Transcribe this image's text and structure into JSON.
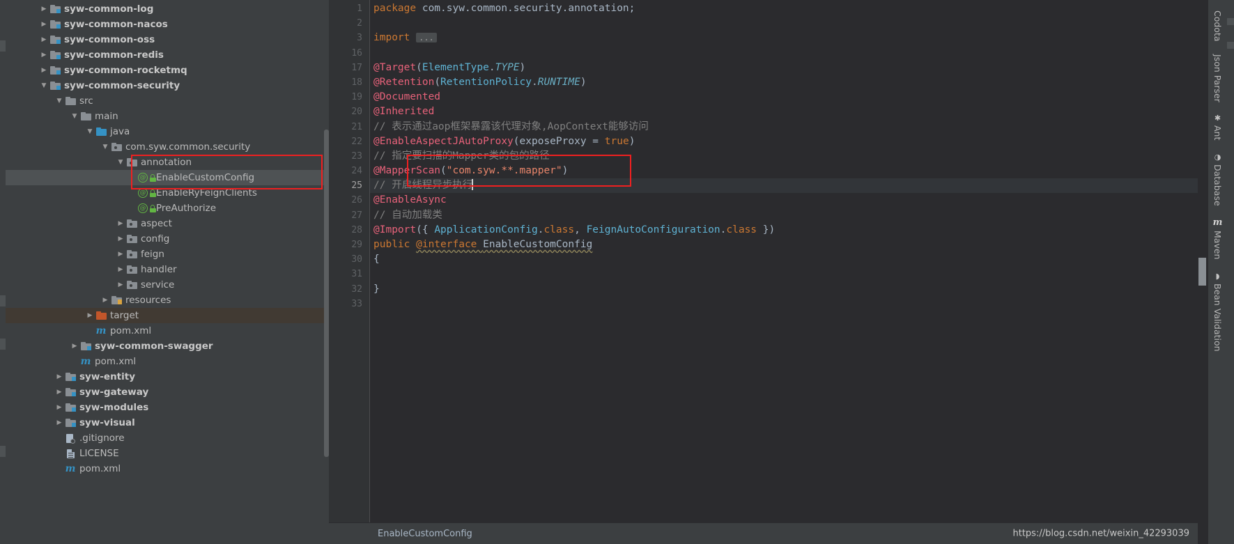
{
  "tree": {
    "rows": [
      {
        "label": "syw-common-log",
        "indent": 1,
        "arrow": "collapsed",
        "icon": "module-folder-icon",
        "bold": true,
        "state": "normal"
      },
      {
        "label": "syw-common-nacos",
        "indent": 1,
        "arrow": "collapsed",
        "icon": "module-folder-icon",
        "bold": true,
        "state": "normal"
      },
      {
        "label": "syw-common-oss",
        "indent": 1,
        "arrow": "collapsed",
        "icon": "module-folder-icon",
        "bold": true,
        "state": "normal"
      },
      {
        "label": "syw-common-redis",
        "indent": 1,
        "arrow": "collapsed",
        "icon": "module-folder-icon",
        "bold": true,
        "state": "normal"
      },
      {
        "label": "syw-common-rocketmq",
        "indent": 1,
        "arrow": "collapsed",
        "icon": "module-folder-icon",
        "bold": true,
        "state": "normal"
      },
      {
        "label": "syw-common-security",
        "indent": 1,
        "arrow": "expanded",
        "icon": "module-folder-icon",
        "bold": true,
        "state": "normal"
      },
      {
        "label": "src",
        "indent": 2,
        "arrow": "expanded",
        "icon": "folder-icon",
        "bold": false,
        "state": "normal"
      },
      {
        "label": "main",
        "indent": 3,
        "arrow": "expanded",
        "icon": "folder-icon",
        "bold": false,
        "state": "normal"
      },
      {
        "label": "java",
        "indent": 4,
        "arrow": "expanded",
        "icon": "source-folder-icon",
        "bold": false,
        "state": "normal"
      },
      {
        "label": "com.syw.common.security",
        "indent": 5,
        "arrow": "expanded",
        "icon": "package-icon",
        "bold": false,
        "state": "normal"
      },
      {
        "label": "annotation",
        "indent": 6,
        "arrow": "expanded",
        "icon": "package-icon",
        "bold": false,
        "state": "normal"
      },
      {
        "label": "EnableCustomConfig",
        "indent": 7,
        "arrow": "none",
        "icon": "annotation-class-icon",
        "bold": false,
        "state": "selected"
      },
      {
        "label": "EnableRyFeignClients",
        "indent": 7,
        "arrow": "none",
        "icon": "annotation-class-icon",
        "bold": false,
        "state": "normal"
      },
      {
        "label": "PreAuthorize",
        "indent": 7,
        "arrow": "none",
        "icon": "annotation-class-icon",
        "bold": false,
        "state": "normal"
      },
      {
        "label": "aspect",
        "indent": 6,
        "arrow": "collapsed",
        "icon": "package-icon",
        "bold": false,
        "state": "normal"
      },
      {
        "label": "config",
        "indent": 6,
        "arrow": "collapsed",
        "icon": "package-icon",
        "bold": false,
        "state": "normal"
      },
      {
        "label": "feign",
        "indent": 6,
        "arrow": "collapsed",
        "icon": "package-icon",
        "bold": false,
        "state": "normal"
      },
      {
        "label": "handler",
        "indent": 6,
        "arrow": "collapsed",
        "icon": "package-icon",
        "bold": false,
        "state": "normal"
      },
      {
        "label": "service",
        "indent": 6,
        "arrow": "collapsed",
        "icon": "package-icon",
        "bold": false,
        "state": "normal"
      },
      {
        "label": "resources",
        "indent": 5,
        "arrow": "collapsed",
        "icon": "resources-folder-icon",
        "bold": false,
        "state": "normal"
      },
      {
        "label": "target",
        "indent": 4,
        "arrow": "collapsed",
        "icon": "excluded-folder-icon",
        "bold": false,
        "state": "target"
      },
      {
        "label": "pom.xml",
        "indent": 4,
        "arrow": "none",
        "icon": "maven-file-icon",
        "bold": false,
        "state": "normal"
      },
      {
        "label": "syw-common-swagger",
        "indent": 3,
        "arrow": "collapsed",
        "icon": "module-folder-icon",
        "bold": true,
        "state": "normal"
      },
      {
        "label": "pom.xml",
        "indent": 3,
        "arrow": "none",
        "icon": "maven-file-icon",
        "bold": false,
        "state": "normal"
      },
      {
        "label": "syw-entity",
        "indent": 2,
        "arrow": "collapsed",
        "icon": "module-folder-icon",
        "bold": true,
        "state": "normal"
      },
      {
        "label": "syw-gateway",
        "indent": 2,
        "arrow": "collapsed",
        "icon": "module-folder-icon",
        "bold": true,
        "state": "normal"
      },
      {
        "label": "syw-modules",
        "indent": 2,
        "arrow": "collapsed",
        "icon": "module-folder-icon",
        "bold": true,
        "state": "normal"
      },
      {
        "label": "syw-visual",
        "indent": 2,
        "arrow": "collapsed",
        "icon": "module-folder-icon",
        "bold": true,
        "state": "normal"
      },
      {
        "label": ".gitignore",
        "indent": 2,
        "arrow": "none",
        "icon": "gitignore-file-icon",
        "bold": false,
        "state": "normal"
      },
      {
        "label": "LICENSE",
        "indent": 2,
        "arrow": "none",
        "icon": "text-file-icon",
        "bold": false,
        "state": "normal"
      },
      {
        "label": "pom.xml",
        "indent": 2,
        "arrow": "none",
        "icon": "maven-file-icon",
        "bold": false,
        "state": "normal"
      }
    ]
  },
  "editor": {
    "gutter_numbers": [
      "1",
      "2",
      "3",
      "16",
      "17",
      "18",
      "19",
      "20",
      "21",
      "22",
      "23",
      "24",
      "25",
      "26",
      "27",
      "28",
      "29",
      "30",
      "31",
      "32",
      "33"
    ],
    "current_line_number": "25",
    "lines": [
      {
        "n": "1",
        "tokens": [
          {
            "t": "package ",
            "c": "kw"
          },
          {
            "t": "com.syw.common.security.annotation;",
            "c": "id"
          }
        ]
      },
      {
        "n": "2",
        "tokens": []
      },
      {
        "n": "3",
        "tokens": [
          {
            "t": "import ",
            "c": "kw"
          },
          {
            "t": "...",
            "c": "chip"
          }
        ]
      },
      {
        "n": "16",
        "tokens": []
      },
      {
        "n": "17",
        "tokens": [
          {
            "t": "@Target",
            "c": "anno"
          },
          {
            "t": "(",
            "c": "punct"
          },
          {
            "t": "ElementType",
            "c": "cls"
          },
          {
            "t": ".",
            "c": "punct"
          },
          {
            "t": "TYPE",
            "c": "const"
          },
          {
            "t": ")",
            "c": "punct"
          }
        ]
      },
      {
        "n": "18",
        "tokens": [
          {
            "t": "@Retention",
            "c": "anno"
          },
          {
            "t": "(",
            "c": "punct"
          },
          {
            "t": "RetentionPolicy",
            "c": "cls"
          },
          {
            "t": ".",
            "c": "punct"
          },
          {
            "t": "RUNTIME",
            "c": "const"
          },
          {
            "t": ")",
            "c": "punct"
          }
        ]
      },
      {
        "n": "19",
        "tokens": [
          {
            "t": "@Documented",
            "c": "anno"
          }
        ]
      },
      {
        "n": "20",
        "tokens": [
          {
            "t": "@Inherited",
            "c": "anno"
          }
        ]
      },
      {
        "n": "21",
        "tokens": [
          {
            "t": "// 表示通过aop框架暴露该代理对象,AopContext能够访问",
            "c": "cmt"
          }
        ]
      },
      {
        "n": "22",
        "tokens": [
          {
            "t": "@EnableAspectJAutoProxy",
            "c": "anno"
          },
          {
            "t": "(",
            "c": "punct"
          },
          {
            "t": "exposeProxy",
            "c": "id"
          },
          {
            "t": " = ",
            "c": "punct"
          },
          {
            "t": "true",
            "c": "kw"
          },
          {
            "t": ")",
            "c": "punct"
          }
        ]
      },
      {
        "n": "23",
        "tokens": [
          {
            "t": "// 指定要扫描的Mapper类的包的路径",
            "c": "cmt"
          }
        ]
      },
      {
        "n": "24",
        "tokens": [
          {
            "t": "@MapperScan",
            "c": "anno"
          },
          {
            "t": "(",
            "c": "punct"
          },
          {
            "t": "\"com.syw.**.mapper\"",
            "c": "str"
          },
          {
            "t": ")",
            "c": "punct"
          }
        ]
      },
      {
        "n": "25",
        "tokens": [
          {
            "t": "// 开启线程异步执行",
            "c": "cmt"
          },
          {
            "t": "",
            "c": "caret"
          }
        ]
      },
      {
        "n": "26",
        "tokens": [
          {
            "t": "@EnableAsync",
            "c": "anno"
          }
        ]
      },
      {
        "n": "27",
        "tokens": [
          {
            "t": "// 自动加载类",
            "c": "cmt"
          }
        ]
      },
      {
        "n": "28",
        "tokens": [
          {
            "t": "@Import",
            "c": "anno"
          },
          {
            "t": "({ ",
            "c": "punct"
          },
          {
            "t": "ApplicationConfig",
            "c": "cls"
          },
          {
            "t": ".",
            "c": "punct"
          },
          {
            "t": "class",
            "c": "kw"
          },
          {
            "t": ", ",
            "c": "punct"
          },
          {
            "t": "FeignAutoConfiguration",
            "c": "cls"
          },
          {
            "t": ".",
            "c": "punct"
          },
          {
            "t": "class",
            "c": "kw"
          },
          {
            "t": " })",
            "c": "punct"
          }
        ]
      },
      {
        "n": "29",
        "tokens": [
          {
            "t": "public ",
            "c": "kw"
          },
          {
            "t": "@interface ",
            "c": "kw-under"
          },
          {
            "t": "EnableCustomConfig",
            "c": "id-warn"
          }
        ]
      },
      {
        "n": "30",
        "tokens": [
          {
            "t": "{",
            "c": "punct"
          }
        ]
      },
      {
        "n": "31",
        "tokens": []
      },
      {
        "n": "32",
        "tokens": [
          {
            "t": "}",
            "c": "punct"
          }
        ]
      },
      {
        "n": "33",
        "tokens": []
      }
    ]
  },
  "breadcrumb": {
    "text": "EnableCustomConfig"
  },
  "watermark": {
    "text": "https://blog.csdn.net/weixin_42293039"
  },
  "right_rail": {
    "items": [
      {
        "label": "Codota",
        "icon": "none"
      },
      {
        "label": "Json Parser",
        "icon": "none"
      },
      {
        "label": "Ant",
        "icon": "ant-icon",
        "glyph": "✱"
      },
      {
        "label": "Database",
        "icon": "database-icon",
        "glyph": "◑"
      },
      {
        "label": "Maven",
        "icon": "maven-icon",
        "glyph": "m"
      },
      {
        "label": "Bean Validation",
        "icon": "bean-icon",
        "glyph": "◗"
      }
    ]
  },
  "colors": {
    "accent": "#3592c4",
    "highlight_box": "#f02020",
    "annotation": "#e8627a",
    "keyword": "#cc7832",
    "string": "#e8856a",
    "comment": "#808080",
    "class": "#5fb3d4",
    "panel_bg": "#3c3f41",
    "editor_bg": "#2b2b2e",
    "selection_bg": "#4e5254"
  }
}
